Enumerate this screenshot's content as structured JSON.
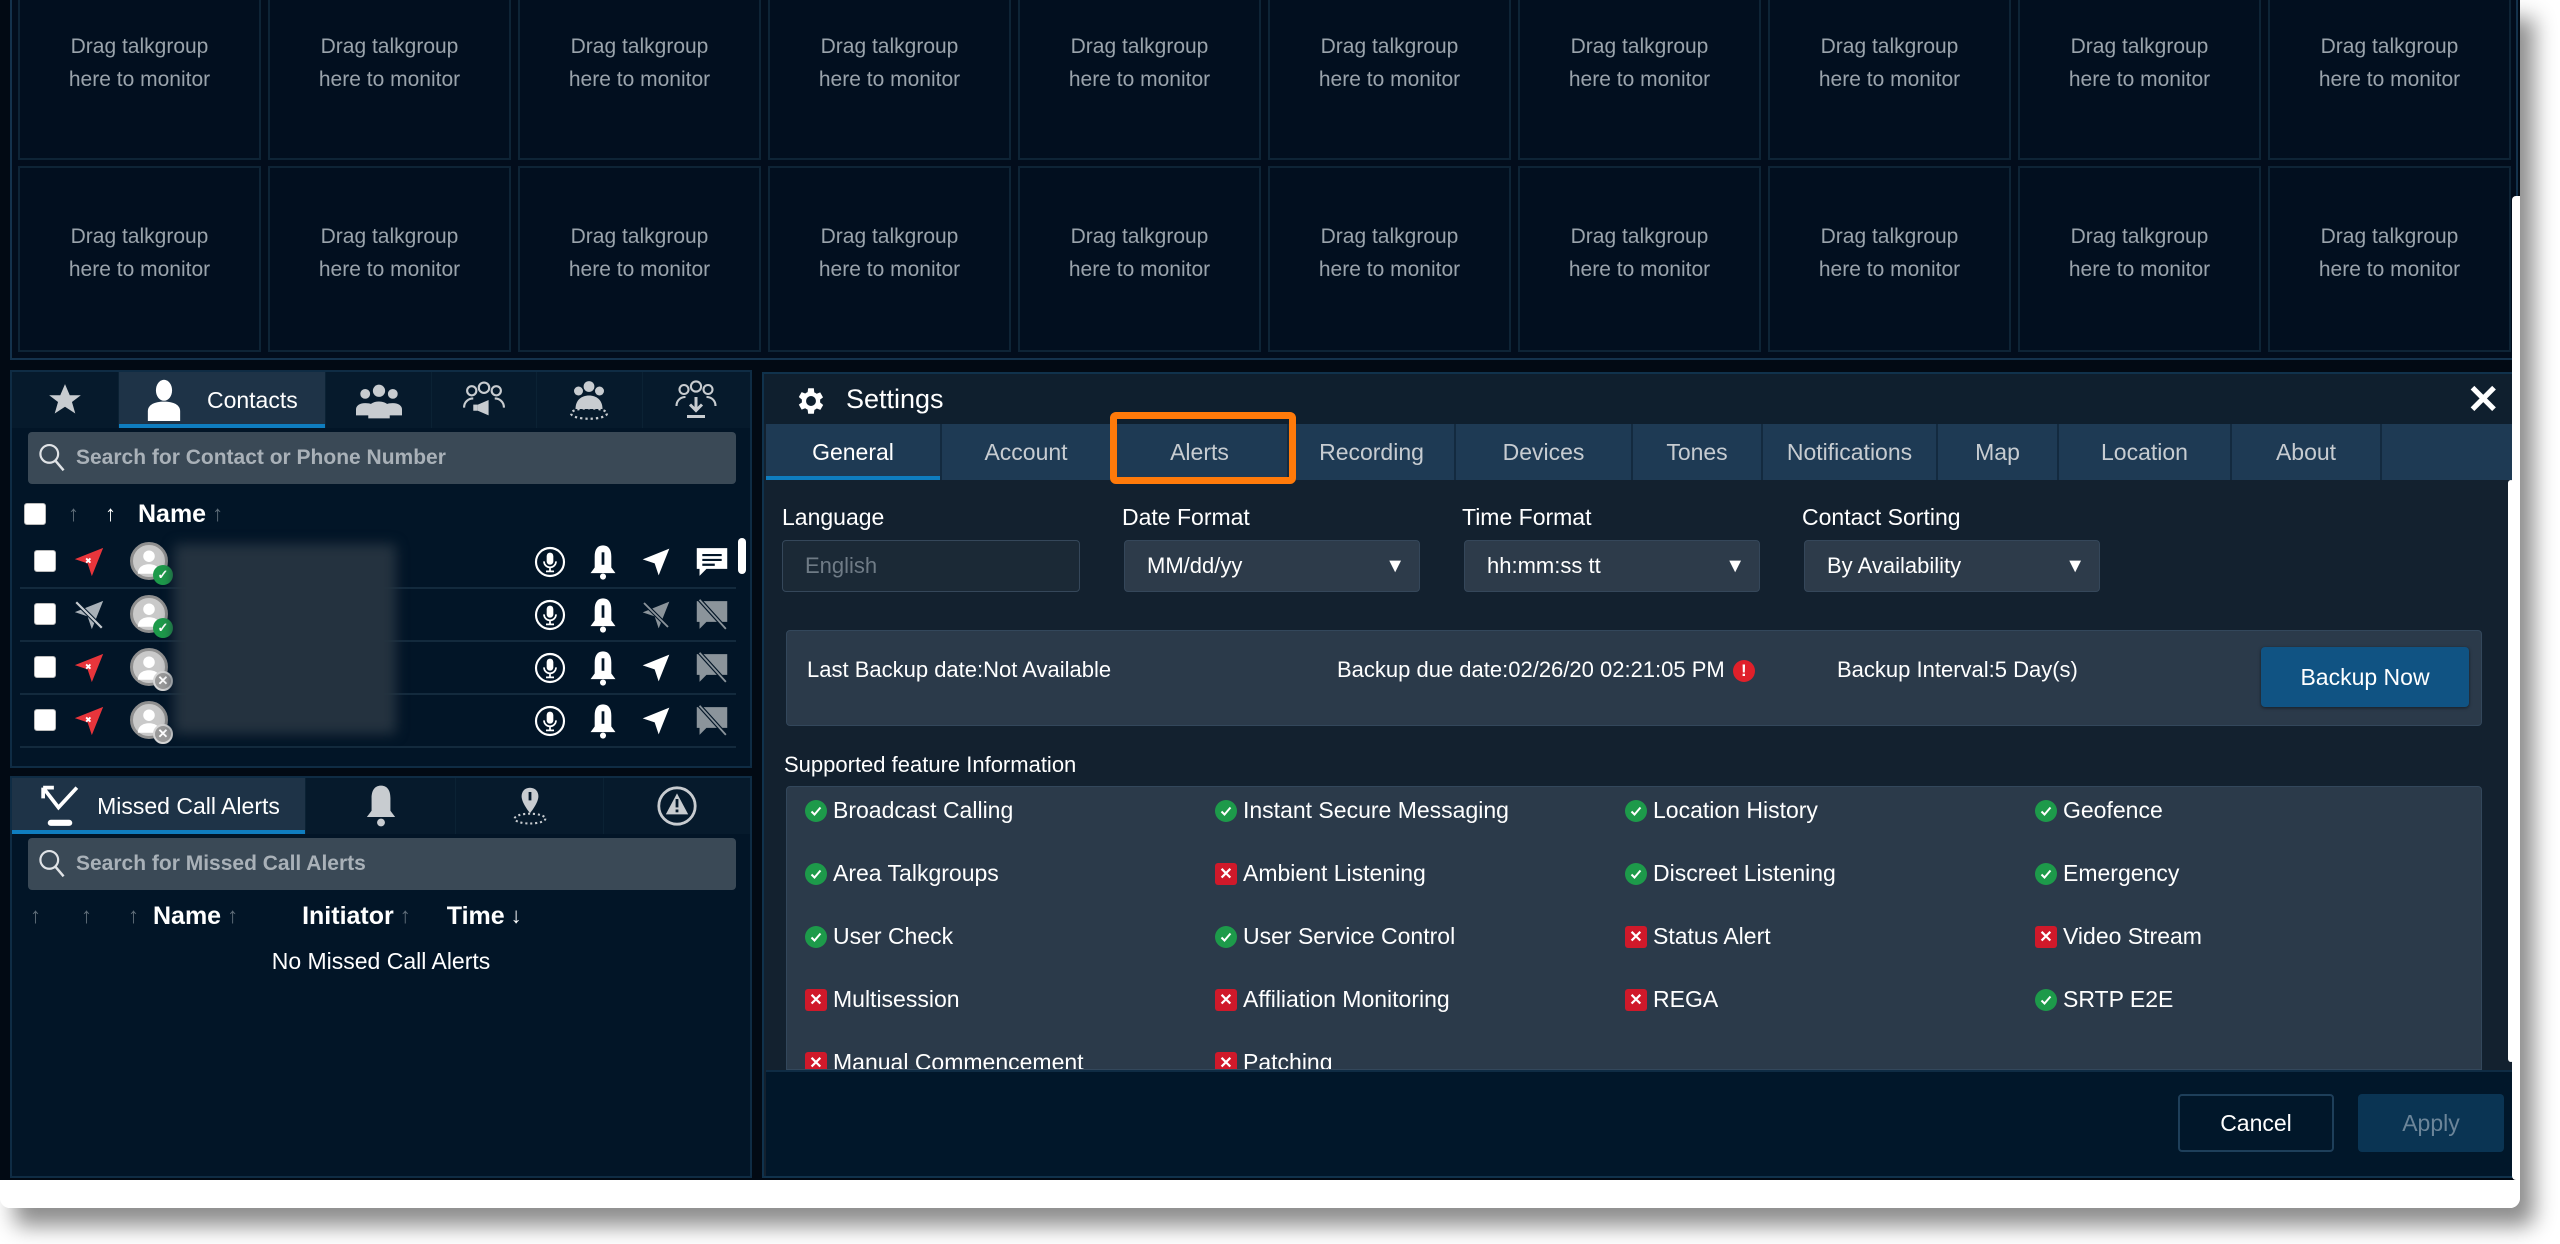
{
  "monitor_grid": {
    "tile_text_line1": "Drag talkgroup",
    "tile_text_line2": "here to monitor",
    "rows": 2,
    "columns": 10
  },
  "contacts_panel": {
    "tabs": [
      {
        "icon": "star-icon",
        "label": ""
      },
      {
        "icon": "person-icon",
        "label": "Contacts",
        "active": true
      },
      {
        "icon": "group-icon",
        "label": ""
      },
      {
        "icon": "broadcast-group-icon",
        "label": ""
      },
      {
        "icon": "area-group-icon",
        "label": ""
      },
      {
        "icon": "group-download-icon",
        "label": ""
      }
    ],
    "search_placeholder": "Search for Contact or Phone Number",
    "header": {
      "name_label": "Name"
    },
    "rows": [
      {
        "location": "red",
        "presence": "available",
        "location_enabled": true,
        "messaging_enabled": true
      },
      {
        "location": "disabled",
        "presence": "available",
        "location_enabled": false,
        "messaging_enabled": false
      },
      {
        "location": "red",
        "presence": "unavailable",
        "location_enabled": true,
        "messaging_enabled": false
      },
      {
        "location": "red",
        "presence": "unavailable",
        "location_enabled": true,
        "messaging_enabled": false
      }
    ]
  },
  "missed_calls_panel": {
    "tabs": [
      {
        "icon": "missed-call-icon",
        "label": "Missed Call Alerts",
        "active": true
      },
      {
        "icon": "bell-icon",
        "label": ""
      },
      {
        "icon": "geofence-icon",
        "label": ""
      },
      {
        "icon": "emergency-icon",
        "label": ""
      }
    ],
    "search_placeholder": "Search for Missed Call Alerts",
    "columns": [
      "Name",
      "Initiator",
      "Time"
    ],
    "empty_text": "No Missed Call Alerts"
  },
  "settings": {
    "title": "Settings",
    "close_label": "✕",
    "tabs": [
      "General",
      "Account",
      "Alerts",
      "Recording",
      "Devices",
      "Tones",
      "Notifications",
      "Map",
      "Location",
      "About"
    ],
    "active_tab": "General",
    "highlighted_tab": "Alerts",
    "fields": {
      "language": {
        "label": "Language",
        "value": "English"
      },
      "date_format": {
        "label": "Date Format",
        "value": "MM/dd/yy"
      },
      "time_format": {
        "label": "Time Format",
        "value": "hh:mm:ss tt"
      },
      "contact_sorting": {
        "label": "Contact Sorting",
        "value": "By Availability"
      }
    },
    "backup": {
      "last_backup": "Last Backup date:Not Available",
      "due_date": "Backup due date:02/26/20 02:21:05 PM",
      "interval": "Backup Interval:5 Day(s)",
      "warning_glyph": "!",
      "button_label": "Backup Now"
    },
    "supported_features_label": "Supported feature Information",
    "features": [
      {
        "name": "Broadcast Calling",
        "supported": true
      },
      {
        "name": "Instant Secure Messaging",
        "supported": true
      },
      {
        "name": "Location History",
        "supported": true
      },
      {
        "name": "Geofence",
        "supported": true
      },
      {
        "name": "Area Talkgroups",
        "supported": true
      },
      {
        "name": "Ambient Listening",
        "supported": false
      },
      {
        "name": "Discreet Listening",
        "supported": true
      },
      {
        "name": "Emergency",
        "supported": true
      },
      {
        "name": "User Check",
        "supported": true
      },
      {
        "name": "User Service Control",
        "supported": true
      },
      {
        "name": "Status Alert",
        "supported": false
      },
      {
        "name": "Video Stream",
        "supported": false
      },
      {
        "name": "Multisession",
        "supported": false
      },
      {
        "name": "Affiliation Monitoring",
        "supported": false
      },
      {
        "name": "REGA",
        "supported": false
      },
      {
        "name": "SRTP E2E",
        "supported": true
      },
      {
        "name": "Manual Commencement",
        "supported": false
      },
      {
        "name": "Patching",
        "supported": false
      }
    ],
    "footer": {
      "cancel_label": "Cancel",
      "apply_label": "Apply"
    }
  },
  "colors": {
    "accent_blue": "#0f7dbf",
    "highlight_orange": "#ff7a0a",
    "ok_green": "#1d9a4a",
    "error_red": "#d0192a"
  }
}
